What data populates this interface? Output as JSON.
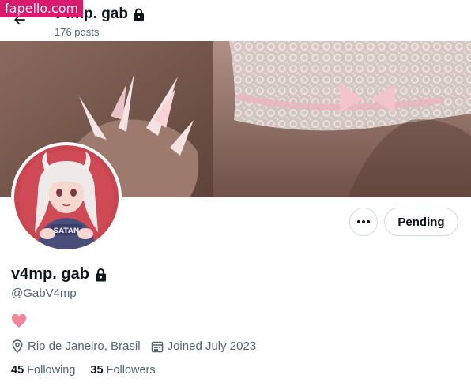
{
  "watermark": "fapello.com",
  "header": {
    "title": "v4mp. gab",
    "posts_count": "176 posts"
  },
  "profile": {
    "display_name": "v4mp. gab",
    "handle": "@GabV4mp",
    "bio_emoji": "heart",
    "avatar_shirt_text": "SATAN",
    "location": "Rio de Janeiro, Brasil",
    "joined": "Joined July 2023"
  },
  "actions": {
    "pending_label": "Pending"
  },
  "stats": {
    "following_count": "45",
    "following_label": "Following",
    "followers_count": "35",
    "followers_label": "Followers"
  },
  "colors": {
    "watermark_bg": "#d91a6d",
    "heart": "#f4869a",
    "secondary_text": "#536471"
  }
}
